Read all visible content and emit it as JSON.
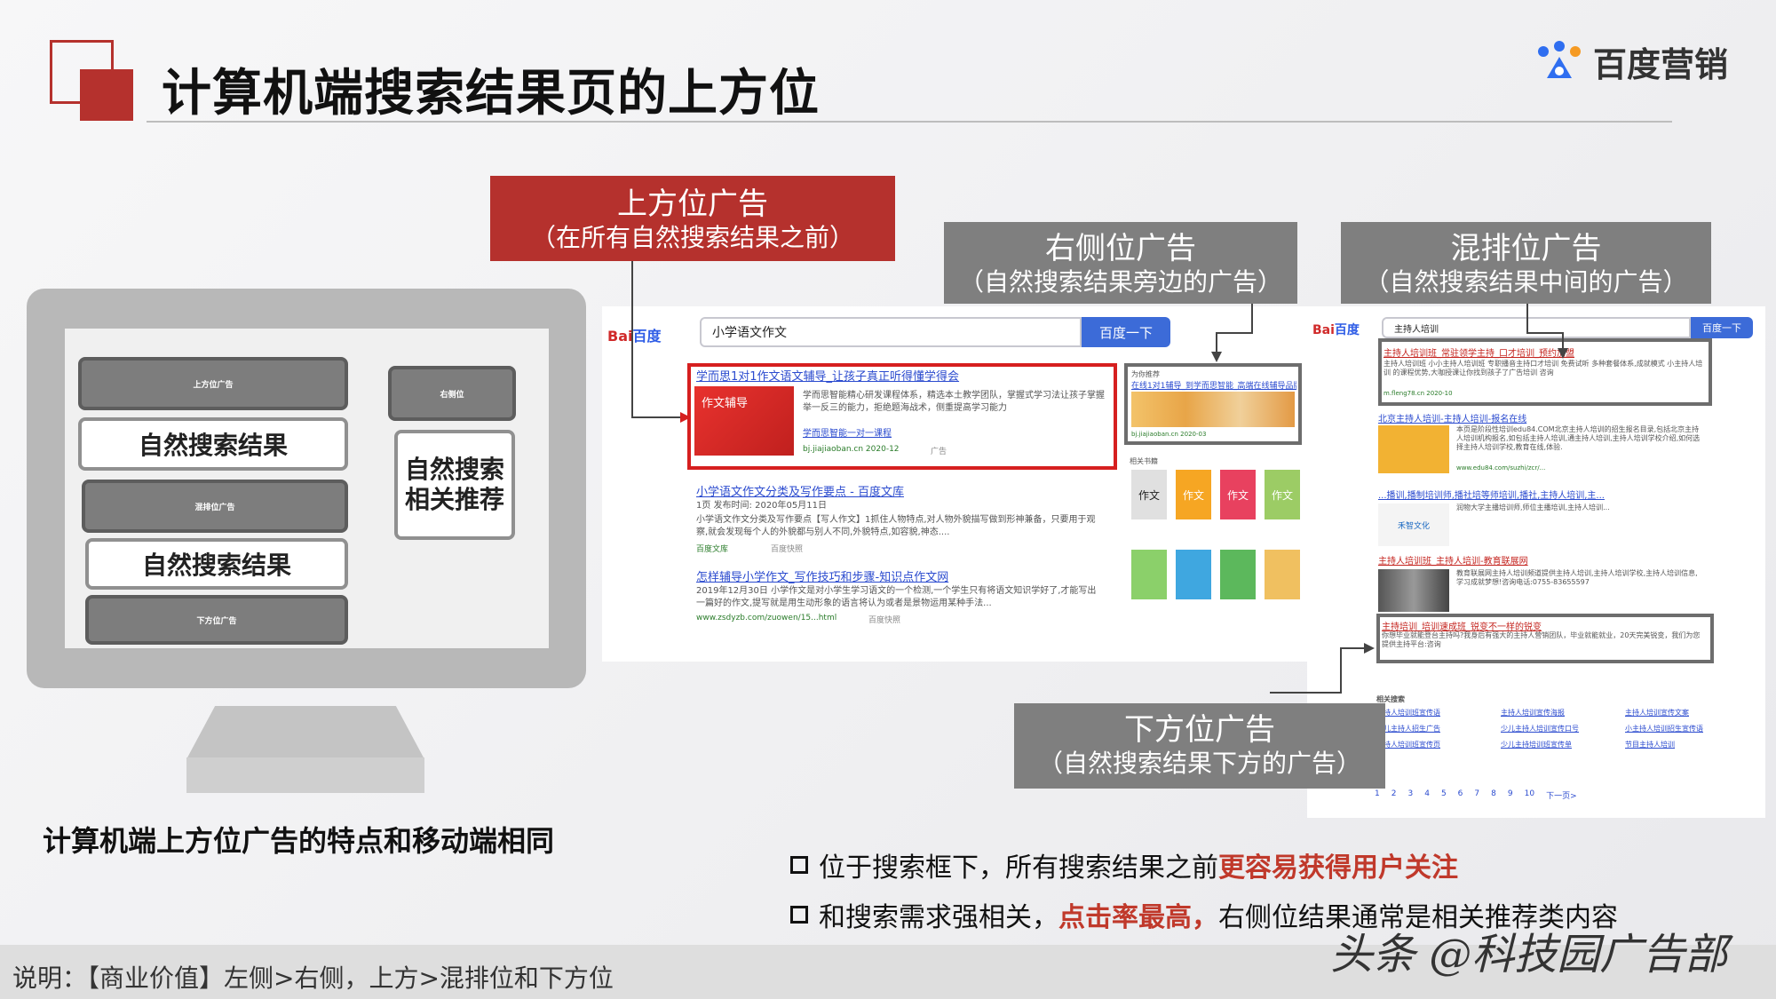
{
  "header": {
    "title": "计算机端搜索结果页的上方位",
    "logo_text": "百度营销"
  },
  "callouts": {
    "top": {
      "title": "上方位广告",
      "sub": "（在所有自然搜索结果之前）"
    },
    "right": {
      "title": "右侧位广告",
      "sub": "（自然搜索结果旁边的广告）"
    },
    "mixed": {
      "title": "混排位广告",
      "sub": "（自然搜索结果中间的广告）"
    },
    "bottom": {
      "title": "下方位广告",
      "sub": "（自然搜索结果下方的广告）"
    }
  },
  "monitor": {
    "top_ad": "上方位广告",
    "organic1": "自然搜索结果",
    "mixed_ad": "混排位广告",
    "organic2": "自然搜索结果",
    "bottom_ad": "下方位广告",
    "right_pos": "右侧位",
    "right_rel": "自然搜索\n相关推荐"
  },
  "note": "计算机端上方位广告的特点和移动端相同",
  "bullets": [
    {
      "text": "位于搜索框下，所有搜索结果之前",
      "highlight": "更容易获得用户关注"
    },
    {
      "text_a": "和搜索需求强相关，",
      "highlight": "点击率最高，",
      "text_b": "右侧位结果通常是相关推荐类内容"
    }
  ],
  "footer": {
    "text": "说明：【商业价值】左侧>右侧，上方>混排位和下方位",
    "watermark": "头条 @科技园广告部"
  },
  "shot1": {
    "logo_a": "Bai",
    "logo_b": "百度",
    "query": "小学语文作文",
    "search_btn": "百度一下",
    "ad_title": "学而思1对1作文语文辅导_让孩子真正听得懂学得会",
    "ad_img": "作文辅导",
    "ad_desc": "学而思智能精心研发课程体系，精选本土教学团队，掌握式学习法让孩子掌握举一反三的能力，拒绝题海战术，侧重提高学习能力",
    "ad_link": "学而思智能一对一课程",
    "ad_url": "bj.jiajiaoban.cn 2020-12",
    "ad_tag": "广告",
    "r1_title": "小学语文作文分类及写作要点 - 百度文库",
    "r1_meta": "1页 发布时间: 2020年05月11日",
    "r1_desc": "小学语文作文分类及写作要点【写人作文】1抓住人物特点,对人物外貌描写做到形神兼备，只要用于观察,就会发现每个人的外貌都与别人不同,外貌特点,如容貌,神态....",
    "r1_src": "百度文库",
    "r1_cache": "百度快照",
    "r2_title": "怎样辅导小学作文_写作技巧和步骤-知识点作文网",
    "r2_desc": "2019年12月30日 小学作文是对小学生学习语文的一个检测,一个学生只有将语文知识学好了,才能写出一篇好的作文,提写就是用生动形象的语言将认为或者是景物运用某种手法...",
    "r2_url": "www.zsdyzb.com/zuowen/15...html",
    "r2_cache": "百度快照",
    "right_head": "为你推荐",
    "right_ad_title": "在线1对1辅导_到学而思智能_高端在线辅导品牌",
    "right_ad_url": "bj.jiajiaoban.cn 2020-03",
    "right_rel": "相关书籍",
    "book1": "作文",
    "book2": "作文",
    "book3": "作文",
    "book4": "作文"
  },
  "shot2": {
    "logo_a": "Bai",
    "logo_b": "百度",
    "query": "主持人培训",
    "search_btn": "百度一下",
    "ad1_title": "主持人培训班_常驻领学主持_口才培训_预约加盟",
    "ad1_desc": "主持人培训班 小小主持人培训班 专职播音主持口才培训 免费试听 多种套餐体系,成就模式 小主持人培训 的课程优势,大咖授课让你找到孩子了广告培训 咨询",
    "ad1_url": "m.fleng78.cn 2020-10",
    "r1_title": "北京主持人培训-主持人培训-报名在线",
    "r1_desc": "本页是阶段性培训edu84.COM北京主持人培训的招生报名目录,包括北京主持人培训机构报名,如包括主持人培训,通主持人培训,主持人培训学校介绍,如何选择主持人培训学校,教育在线,体验.",
    "r1_url": "www.edu84.com/suzhi/zcr/...",
    "r2_title": "...播训,播制培训师,播社培等师培训,播社,主持人培训,主...",
    "r2_desc": "润物大学主播培训师,师位主播培训,主持人培训...",
    "r2_brand": "禾智文化",
    "r3_title": "主持人培训班_主持人培训-教育联展网",
    "r3_desc": "教育联展网主持人培训频道提供主持人培训,主持人培训学校,主持人培训信息, 学习成就梦想!咨询电话:0755-83655597",
    "ad2_title": "主持培训_培训速成班_锐变不一样的锐变",
    "ad2_desc": "你想毕业就能登台主持吗?我身后有强大的主持人营销团队，毕业就能就业，20天完美锐变，我们为您提供主持平台:咨询",
    "related_head": "相关搜索",
    "related": [
      "主持人培训班宣传语",
      "主持人培训宣传海报",
      "主持人培训宣传文案",
      "少儿主持人招生广告",
      "少儿主持人培训宣传口号",
      "小主持人培训招生宣传语",
      "主持人培训班宣传页",
      "少儿主持培训班宣传单",
      "节目主持人培训"
    ],
    "pages": [
      "1",
      "2",
      "3",
      "4",
      "5",
      "6",
      "7",
      "8",
      "9",
      "10",
      "下一页>"
    ]
  }
}
